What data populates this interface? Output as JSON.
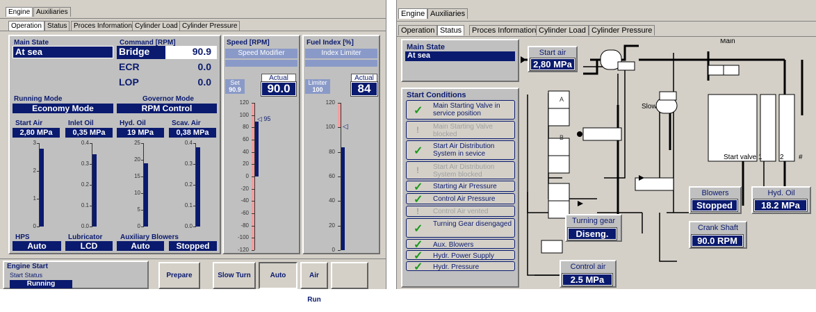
{
  "left": {
    "tabs_top": [
      "Engine",
      "Auxiliaries"
    ],
    "tabs": [
      "Operation",
      "Status",
      "Proces Information",
      "Cylinder Load",
      "Cylinder Pressure"
    ],
    "main_state": {
      "label": "Main State",
      "value": "At sea"
    },
    "command": {
      "label": "Command [RPM]",
      "rows": [
        {
          "name": "Bridge",
          "value": "90.9"
        },
        {
          "name": "ECR",
          "value": "0.0"
        },
        {
          "name": "LOP",
          "value": "0.0"
        }
      ]
    },
    "running_mode": {
      "label": "Running Mode",
      "value": "Economy Mode"
    },
    "governor_mode": {
      "label": "Governor Mode",
      "value": "RPM Control"
    },
    "gauges": [
      {
        "label": "Start Air",
        "value": "2,80 MPa",
        "ticks": [
          "3",
          "2",
          "1",
          "0"
        ],
        "level": 0.93
      },
      {
        "label": "Inlet Oil",
        "value": "0,35 MPa",
        "ticks": [
          "0.4",
          "0.3",
          "0.2",
          "0.1",
          "0.0"
        ],
        "level": 0.87
      },
      {
        "label": "Hyd. Oil",
        "value": "19 MPa",
        "ticks": [
          "25",
          "20",
          "15",
          "10",
          "5",
          "0"
        ],
        "level": 0.76
      },
      {
        "label": "Scav. Air",
        "value": "0,38 MPa",
        "ticks": [
          "0.4",
          "0.3",
          "0.2",
          "0.1",
          "0.0"
        ],
        "level": 0.95
      }
    ],
    "hps": {
      "label": "HPS",
      "value": "Auto"
    },
    "lubricator": {
      "label": "Lubricator",
      "value": "LCD"
    },
    "aux_blowers": {
      "label": "Auxiliary Blowers",
      "mode": "Auto",
      "state": "Stopped"
    },
    "speed": {
      "label": "Speed [RPM]",
      "modifier": "Speed Modifier",
      "set_label": "Set",
      "set_value": "90.9",
      "actual_label": "Actual",
      "actual_value": "90.0",
      "ticks": [
        "120",
        "100",
        "80",
        "60",
        "40",
        "20",
        "0",
        "-20",
        "-40",
        "-60",
        "-80",
        "-100",
        "-120"
      ],
      "marker": "95"
    },
    "fuel": {
      "label": "Fuel Index [%]",
      "limiter": "Index Limiter",
      "limiter_label": "Limiter",
      "limiter_value": "100",
      "actual_label": "Actual",
      "actual_value": "84",
      "ticks": [
        "120",
        "100",
        "80",
        "60",
        "40",
        "20",
        "0"
      ]
    },
    "engine_start": {
      "label": "Engine Start",
      "status_label": "Start Status",
      "status_value": "Running"
    },
    "buttons": [
      "Prepare",
      "Slow Turn",
      "Auto",
      "Air Run"
    ]
  },
  "right": {
    "tabs_top": [
      "Engine",
      "Auxiliaries"
    ],
    "tabs": [
      "Operation",
      "Status",
      "Proces Information",
      "Cylinder Load",
      "Cylinder Pressure"
    ],
    "main_state": {
      "label": "Main State",
      "value": "At sea"
    },
    "start_conditions_label": "Start Conditions",
    "conditions": [
      {
        "text": "Main Starting Valve in service position",
        "ok": true
      },
      {
        "text": "Main Starting Valve blocked",
        "ok": false
      },
      {
        "text": "Start Air Distribution System in sevice",
        "ok": true
      },
      {
        "text": "Start Air Distribution System blocked",
        "ok": false
      },
      {
        "text": "Starting Air Pressure",
        "ok": true
      },
      {
        "text": "Control Air Pressure",
        "ok": true
      },
      {
        "text": "Control Air vented",
        "ok": false
      },
      {
        "text": "Turning Gear disengaged",
        "ok": true
      },
      {
        "text": "Aux. Blowers",
        "ok": true
      },
      {
        "text": "Hydr. Power Supply",
        "ok": true
      },
      {
        "text": "Hydr. Pressure",
        "ok": true
      }
    ],
    "start_air": {
      "label": "Start air",
      "value": "2,80 MPa"
    },
    "main_label": "Main",
    "slow_label": "Slow",
    "valve_labels": [
      "A",
      "B"
    ],
    "turning_gear": {
      "label": "Turning gear",
      "value": "Diseng."
    },
    "control_air": {
      "label": "Control air",
      "value": "2.5 MPa"
    },
    "blowers": {
      "label": "Blowers",
      "value": "Stopped"
    },
    "hyd_oil": {
      "label": "Hyd. Oil",
      "value": "18.2 MPa"
    },
    "crank_shaft": {
      "label": "Crank Shaft",
      "value": "90.0 RPM"
    },
    "start_valves": [
      "Start valve 1",
      "2",
      "#"
    ]
  },
  "colors": {
    "navy": "#0a1a6e",
    "panel": "#c0c0c0",
    "ok": "#1a9a1a",
    "dim": "#a0a0a0"
  }
}
